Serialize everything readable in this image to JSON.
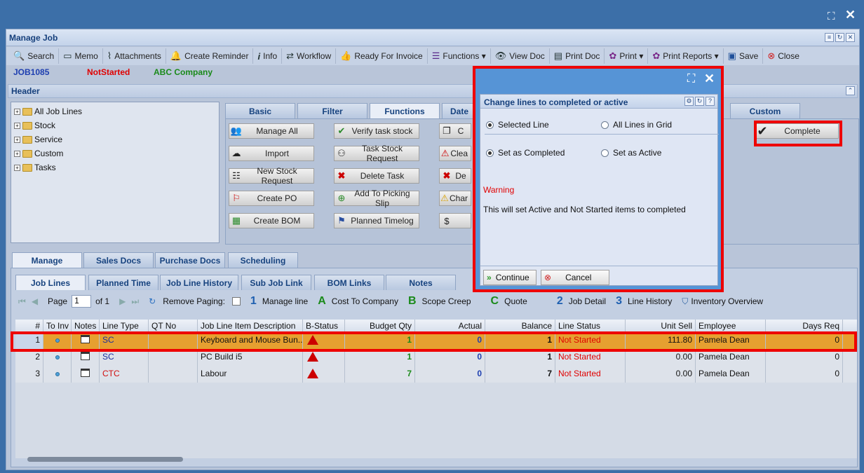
{
  "outer": {
    "maximize_icon": "maximize-icon",
    "close_icon": "close-icon"
  },
  "window": {
    "title": "Manage Job"
  },
  "toolbar": [
    {
      "icon": "search-icon",
      "label": "Search"
    },
    {
      "icon": "memo-icon",
      "label": "Memo"
    },
    {
      "icon": "paperclip-icon",
      "label": "Attachments"
    },
    {
      "icon": "bell-icon",
      "label": "Create Reminder"
    },
    {
      "icon": "info-icon",
      "label": "Info"
    },
    {
      "icon": "workflow-icon",
      "label": "Workflow"
    },
    {
      "icon": "thumbs-up-icon",
      "label": "Ready For Invoice"
    },
    {
      "icon": "menu-icon",
      "label": "Functions ▾"
    },
    {
      "icon": "eye-icon",
      "label": "View Doc"
    },
    {
      "icon": "print-doc-icon",
      "label": "Print Doc"
    },
    {
      "icon": "print-icon",
      "label": "Print ▾"
    },
    {
      "icon": "print-reports-icon",
      "label": "Print Reports ▾"
    },
    {
      "icon": "save-icon",
      "label": "Save"
    },
    {
      "icon": "close-circle-icon",
      "label": "Close"
    }
  ],
  "job": {
    "number": "JOB1085",
    "status": "NotStarted",
    "company": "ABC Company",
    "status_color": "#e00000",
    "company_color": "#1a8a1a"
  },
  "header_section": {
    "title": "Header"
  },
  "tree": [
    "All Job Lines",
    "Stock",
    "Service",
    "Custom",
    "Tasks"
  ],
  "function_tabs": [
    "Basic",
    "Filter",
    "Functions",
    "Date",
    "Custom"
  ],
  "function_buttons": {
    "col1": [
      "Manage All",
      "Import",
      "New Stock Request",
      "Create PO",
      "Create BOM"
    ],
    "col2": [
      "Verify task stock",
      "Task Stock Request",
      "Delete Task",
      "Add To Picking Slip",
      "Planned Timelog"
    ],
    "col3": [
      "C",
      "Clea",
      "De",
      "Char",
      ""
    ],
    "complete": "Complete"
  },
  "main_tabs": [
    "Manage",
    "Sales Docs",
    "Purchase Docs",
    "Scheduling"
  ],
  "sub_tabs": [
    "Job Lines",
    "Planned Time",
    "Job Line History",
    "Sub Job Link",
    "BOM Links",
    "Notes"
  ],
  "pager": {
    "page_label": "Page",
    "page_value": "1",
    "of_label": "of 1",
    "remove_paging": "Remove Paging:",
    "legend": [
      {
        "glyph": "1",
        "label": "Manage line",
        "color": "#1e5fb0"
      },
      {
        "glyph": "A",
        "label": "Cost To Company",
        "color": "#1a8a1a"
      },
      {
        "glyph": "B",
        "label": "Scope Creep",
        "color": "#1a8a1a"
      },
      {
        "glyph": "C",
        "label": "Quote",
        "color": "#1a8a1a"
      },
      {
        "glyph": "2",
        "label": "Job Detail",
        "color": "#1e5fb0"
      },
      {
        "glyph": "3",
        "label": "Line History",
        "color": "#1e5fb0"
      }
    ],
    "inventory": "Inventory Overview"
  },
  "grid": {
    "columns": [
      "#",
      "To Inv",
      "Notes",
      "Line Type",
      "QT No",
      "Job Line Item Description",
      "B-Status",
      "Budget Qty",
      "Actual",
      "Balance",
      "Line Status",
      "Unit Sell",
      "Employee",
      "Days Req"
    ],
    "rows": [
      {
        "n": "1",
        "type": "SC",
        "type_color": "#1a2fa0",
        "qt": "",
        "desc": "Keyboard and Mouse Bun...",
        "budget": "1",
        "actual": "0",
        "balance": "1",
        "status": "Not Started",
        "sell": "111.80",
        "emp": "Pamela Dean",
        "days": "0"
      },
      {
        "n": "2",
        "type": "SC",
        "type_color": "#1a2fa0",
        "qt": "",
        "desc": "PC Build i5",
        "budget": "1",
        "actual": "0",
        "balance": "1",
        "status": "Not Started",
        "sell": "0.00",
        "emp": "Pamela Dean",
        "days": "0"
      },
      {
        "n": "3",
        "type": "CTC",
        "type_color": "#d01010",
        "qt": "",
        "desc": "Labour",
        "budget": "7",
        "actual": "0",
        "balance": "7",
        "status": "Not Started",
        "sell": "0.00",
        "emp": "Pamela Dean",
        "days": "0"
      }
    ]
  },
  "modal": {
    "title": "Change lines to completed or active",
    "opt_selected": "Selected Line",
    "opt_all": "All Lines in Grid",
    "opt_completed": "Set as Completed",
    "opt_active": "Set as Active",
    "warning_title": "Warning",
    "warning_text": "This will set Active and Not Started items to completed",
    "continue": "Continue",
    "cancel": "Cancel"
  }
}
